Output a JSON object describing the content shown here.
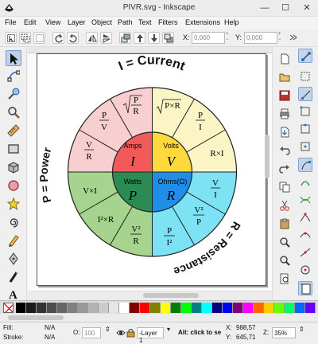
{
  "window": {
    "title": "PIVR.svg - Inkscape",
    "minimize": "—",
    "maximize": "☐",
    "close": "✕"
  },
  "menu": [
    "File",
    "Edit",
    "View",
    "Layer",
    "Object",
    "Path",
    "Text",
    "Filters",
    "Extensions",
    "Help"
  ],
  "coords": {
    "x_label": "X:",
    "x_value": "0,000",
    "y_label": "Y:",
    "y_value": "0,000"
  },
  "tools": [
    "select-tool-icon",
    "node-tool-icon",
    "tweak-tool-icon",
    "zoom-tool-icon",
    "measure-tool-icon",
    "rectangle-tool-icon",
    "3d-box-tool-icon",
    "ellipse-tool-icon",
    "star-tool-icon",
    "spiral-tool-icon",
    "pencil-tool-icon",
    "pen-tool-icon",
    "calligraphy-tool-icon",
    "text-tool-icon"
  ],
  "diagram": {
    "title_top": "I = Current",
    "title_left": "P = Power",
    "title_right": "R = Resistance",
    "quadrants": {
      "current": {
        "label": "Amps",
        "symbol": "I",
        "color": "#f25a5a",
        "outer_color": "#f8cfd0"
      },
      "voltage": {
        "label": "Volts",
        "symbol": "V",
        "color": "#ffd93c",
        "outer_color": "#fbf4c4"
      },
      "power": {
        "label": "Watts",
        "symbol": "P",
        "color": "#2a8c52",
        "outer_color": "#a6d48f"
      },
      "resistance": {
        "label": "Ohms(Ω)",
        "symbol": "R",
        "color": "#1f8ee8",
        "outer_color": "#7ee2f5"
      }
    },
    "formulas": {
      "current": [
        {
          "num": "P",
          "den": "R",
          "sqrt": true
        },
        {
          "num": "P",
          "den": "V"
        },
        {
          "num": "V",
          "den": "R"
        }
      ],
      "voltage": [
        {
          "text": "P×R",
          "sqrt": true
        },
        {
          "num": "P",
          "den": "I"
        },
        {
          "text": "R×I"
        }
      ],
      "power": [
        {
          "text": "V×I"
        },
        {
          "text": "I²×R"
        },
        {
          "num": "V²",
          "den": "R"
        }
      ],
      "resistance": [
        {
          "num": "V",
          "den": "I"
        },
        {
          "num": "V²",
          "den": "P"
        },
        {
          "num": "P",
          "den": "I²"
        }
      ]
    }
  },
  "palette": [
    "#000000",
    "#1a1a1a",
    "#333333",
    "#4d4d4d",
    "#666666",
    "#808080",
    "#999999",
    "#b3b3b3",
    "#cccccc",
    "#e6e6e6",
    "#ffffff",
    "#800000",
    "#ff0000",
    "#808000",
    "#ffff00",
    "#008000",
    "#00ff00",
    "#008080",
    "#00ffff",
    "#000080",
    "#0000ff",
    "#800080",
    "#ff00ff",
    "#ff6600",
    "#ffcc00",
    "#66ff00",
    "#00ff66",
    "#0066ff",
    "#6600ff"
  ],
  "status": {
    "fill_label": "Fill:",
    "fill_value": "N/A",
    "stroke_label": "Stroke:",
    "stroke_value": "N/A",
    "opacity_label": "O:",
    "opacity_value": "100",
    "layer": "-Layer 1",
    "hint": "Alt: click to se",
    "x_label": "X:",
    "x_value": "988,57",
    "y_label": "Y:",
    "y_value": "645,71",
    "zoom_label": "Z:",
    "zoom_value": "35%"
  }
}
